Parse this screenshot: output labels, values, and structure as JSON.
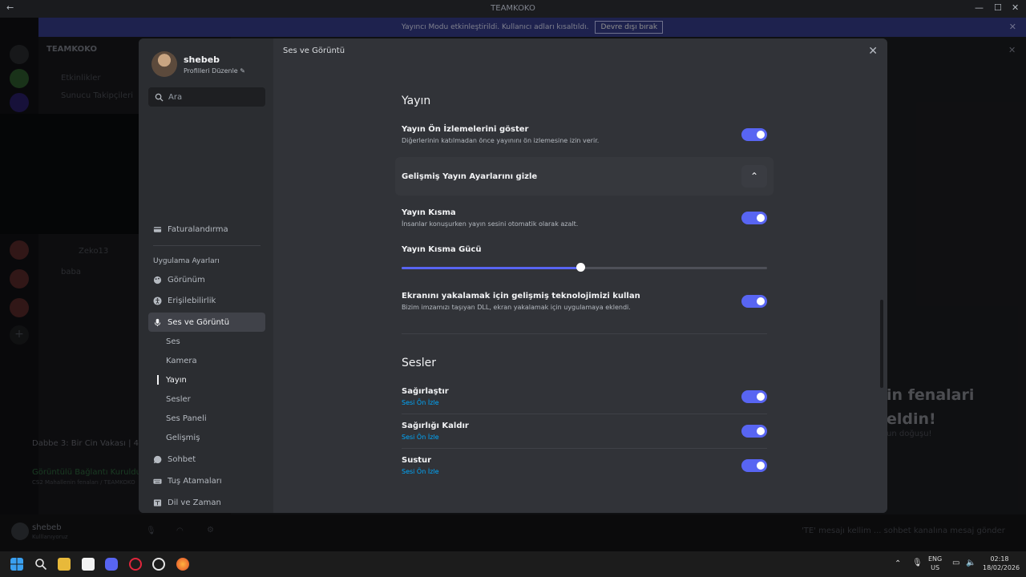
{
  "window": {
    "title": "TEAMKOKO"
  },
  "banner": {
    "text": "Yayıncı Modu etkinleştirildi. Kullanıcı adları kısaltıldı.",
    "button": "Devre dışı bırak"
  },
  "background": {
    "server_name": "TEAMKOKO",
    "channel_events": "Etkinlikler",
    "channel_tracking": "Sunucu Takipçileri",
    "voice_user_1": "Zeko13",
    "voice_user_2": "baba",
    "activity_title": "Dabbe 3: Bir Cin Vakası | 4K",
    "voice_connected": "Görüntülü Bağlantı Kuruldu",
    "voice_channel": "CS2 Mahallenin fenaları / TEAMKOKO",
    "user_name": "shebeb",
    "user_status": "Kulllanıyoruz",
    "chat_text_1": "in fenalari",
    "chat_text_2": "eldin!",
    "chat_small": "un doğuşu!",
    "message_placeholder": "'TE' mesajı kellim ... sohbet kanalına mesaj gönder"
  },
  "profile": {
    "name": "shebeb",
    "edit_label": "Profilleri Düzenle"
  },
  "search": {
    "placeholder": "Ara"
  },
  "sidebar": {
    "billing": "Faturalandırma",
    "app_settings_header": "Uygulama Ayarları",
    "items": [
      {
        "label": "Görünüm",
        "icon": "palette-icon"
      },
      {
        "label": "Erişilebilirlik",
        "icon": "accessibility-icon"
      },
      {
        "label": "Ses ve Görüntü",
        "icon": "microphone-icon"
      }
    ],
    "sub_items": [
      "Ses",
      "Kamera",
      "Yayın",
      "Sesler",
      "Ses Paneli",
      "Gelişmiş"
    ],
    "after_items": [
      {
        "label": "Sohbet",
        "icon": "chat-icon"
      },
      {
        "label": "Tuş Atamaları",
        "icon": "keyboard-icon"
      },
      {
        "label": "Dil ve Zaman",
        "icon": "language-icon"
      }
    ]
  },
  "header": {
    "title": "Ses ve Görüntü"
  },
  "stream_section": {
    "title": "Yayın",
    "preview": {
      "title": "Yayın Ön İzlemelerini göster",
      "desc": "Diğerlerinin katılmadan önce yayınını ön izlemesine izin verir.",
      "enabled": true
    },
    "advanced": {
      "title": "Gelişmiş Yayın Ayarlarını gizle"
    },
    "attenuation": {
      "title": "Yayın Kısma",
      "desc": "İnsanlar konuşurken yayın sesini otomatik olarak azalt.",
      "enabled": true
    },
    "attenuation_strength": {
      "title": "Yayın Kısma Gücü",
      "value": 0.49
    },
    "capture": {
      "title": "Ekranını yakalamak için gelişmiş teknolojimizi kullan",
      "desc": "Bizim imzamızı taşıyan DLL, ekran yakalamak için uygulamaya eklendi.",
      "enabled": true
    }
  },
  "sounds_section": {
    "title": "Sesler",
    "items": [
      {
        "title": "Sağırlaştır",
        "link": "Sesi Ön İzle",
        "enabled": true
      },
      {
        "title": "Sağırlığı Kaldır",
        "link": "Sesi Ön İzle",
        "enabled": true
      },
      {
        "title": "Sustur",
        "link": "Sesi Ön İzle",
        "enabled": true
      }
    ]
  },
  "taskbar": {
    "lang": "ENG",
    "region": "US",
    "time": "02:18",
    "date": "18/02/2026"
  },
  "colors": {
    "accent": "#5865f2",
    "link": "#00a8fc"
  }
}
